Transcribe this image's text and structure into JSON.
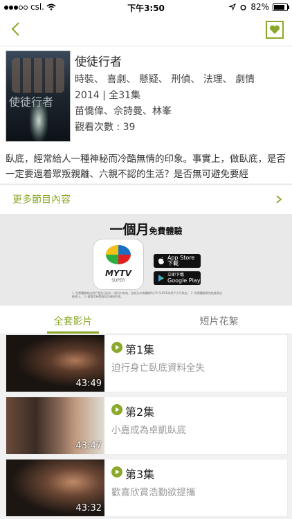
{
  "status": {
    "carrier": "csl.",
    "time": "下午3:50",
    "battery": "82%",
    "battery_level": 0.82
  },
  "show": {
    "title": "使徒行者",
    "genres": "時裝、 喜劇、 懸疑、 刑偵、 法理、 劇情",
    "year_eps": "2014 | 全31集",
    "cast": "苗僑偉、佘詩曼、林峯",
    "views": "觀看次數 : 39",
    "poster_text": "使徒行者",
    "description": "臥底，經常給人一種神秘而冷酷無情的印象。事實上，做臥底，是否一定要過着眾叛親離、六親不認的生活？是否無可避免要經"
  },
  "more_label": "更多節目內容",
  "banner": {
    "headline_big": "一個月",
    "headline_small": "免費體驗",
    "logo_text": "MYTV",
    "logo_sub": "SUPER",
    "appstore_line1": "App Store",
    "appstore_line2": "下載",
    "googleplay_line1": "立即下載",
    "googleplay_line2": "Google Play",
    "fineprint": "1. 免費體驗期由用戶登記日起計一個月內有效，全新及未曾體驗MyTV SUPER的用戶方可參加。 2. 免費體驗期完結後將自動終止。 3. 優惠受有關條款及細則約束。"
  },
  "tabs": [
    "全套影片",
    "短片花絮"
  ],
  "episodes": [
    {
      "title": "第1集",
      "subtitle": "迫行身亡臥底資料全失",
      "duration": "43:49"
    },
    {
      "title": "第2集",
      "subtitle": "小嘉成為卓凱臥底",
      "duration": "43:47"
    },
    {
      "title": "第3集",
      "subtitle": "歡喜欣賞浩勤欲提攜",
      "duration": "43:32"
    }
  ],
  "colors": {
    "accent": "#8aa82a"
  }
}
